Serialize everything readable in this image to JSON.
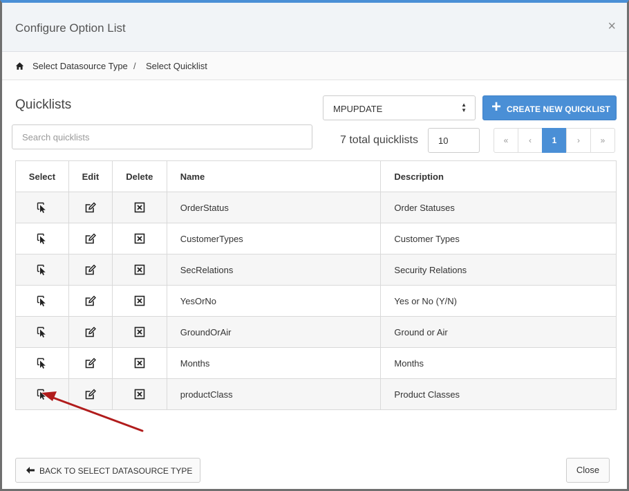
{
  "modal": {
    "title": "Configure Option List",
    "close_glyph": "×"
  },
  "breadcrumb": {
    "items": [
      "Select Datasource Type",
      "Select Quicklist"
    ],
    "separator": "/"
  },
  "quicklists": {
    "title": "Quicklists",
    "datasource_select_value": "MPUPDATE",
    "create_button_label": "CREATE NEW QUICKLIST",
    "search_placeholder": "Search quicklists",
    "total_label": "7 total quicklists",
    "page_size": "10"
  },
  "pagination": {
    "first": "«",
    "prev": "‹",
    "current": "1",
    "next": "›",
    "last": "»"
  },
  "table": {
    "headers": {
      "select": "Select",
      "edit": "Edit",
      "delete": "Delete",
      "name": "Name",
      "description": "Description"
    },
    "rows": [
      {
        "name": "OrderStatus",
        "description": "Order Statuses"
      },
      {
        "name": "CustomerTypes",
        "description": "Customer Types"
      },
      {
        "name": "SecRelations",
        "description": "Security Relations"
      },
      {
        "name": "YesOrNo",
        "description": "Yes or No (Y/N)"
      },
      {
        "name": "GroundOrAir",
        "description": "Ground or Air"
      },
      {
        "name": "Months",
        "description": "Months"
      },
      {
        "name": "productClass",
        "description": "Product Classes"
      }
    ]
  },
  "footer": {
    "back_label": "BACK TO SELECT DATASOURCE TYPE",
    "close_label": "Close"
  },
  "colors": {
    "primary": "#4a8fd6",
    "annotation_arrow": "#b11c1c"
  },
  "icons": {
    "home": "home-icon",
    "select": "cursor-select-icon",
    "edit": "edit-icon",
    "delete": "delete-icon",
    "plus": "plus-icon",
    "back": "arrow-left-icon",
    "sort": "sort-arrows-icon"
  }
}
